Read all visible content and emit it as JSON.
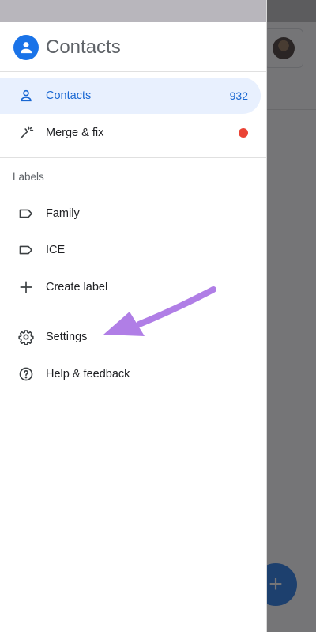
{
  "app": {
    "title": "Contacts"
  },
  "nav": {
    "items": [
      {
        "label": "Contacts",
        "count": "932",
        "icon": "person-icon",
        "active": true
      },
      {
        "label": "Merge & fix",
        "icon": "magic-wand-icon",
        "badge": "red-dot"
      }
    ]
  },
  "labels": {
    "heading": "Labels",
    "items": [
      {
        "label": "Family",
        "icon": "label-icon"
      },
      {
        "label": "ICE",
        "icon": "label-icon"
      },
      {
        "label": "Create label",
        "icon": "plus-icon"
      }
    ]
  },
  "footer_nav": {
    "items": [
      {
        "label": "Settings",
        "icon": "gear-icon"
      },
      {
        "label": "Help & feedback",
        "icon": "help-icon"
      }
    ]
  },
  "colors": {
    "accent": "#1a73e8",
    "active_bg": "#e8f0fe",
    "badge_dot": "#ea4335",
    "annotation_arrow": "#b07ee6"
  }
}
